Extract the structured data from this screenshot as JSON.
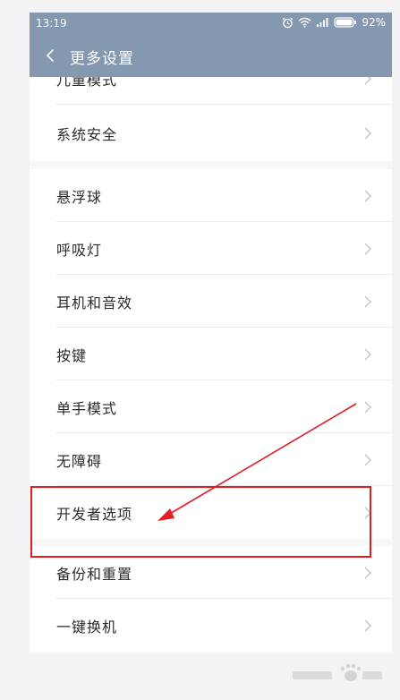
{
  "status_bar": {
    "time": "13:19",
    "battery": "92%"
  },
  "title_bar": {
    "title": "更多设置"
  },
  "groups": [
    {
      "items": [
        {
          "label": "儿童模式"
        },
        {
          "label": "系统安全"
        }
      ]
    },
    {
      "items": [
        {
          "label": "悬浮球"
        },
        {
          "label": "呼吸灯"
        },
        {
          "label": "耳机和音效"
        },
        {
          "label": "按键"
        },
        {
          "label": "单手模式"
        },
        {
          "label": "无障碍"
        },
        {
          "label": "开发者选项"
        }
      ]
    },
    {
      "items": [
        {
          "label": "备份和重置"
        },
        {
          "label": "一键换机"
        }
      ]
    }
  ],
  "colors": {
    "header": "#8499b0",
    "annotation": "#e01e24"
  }
}
